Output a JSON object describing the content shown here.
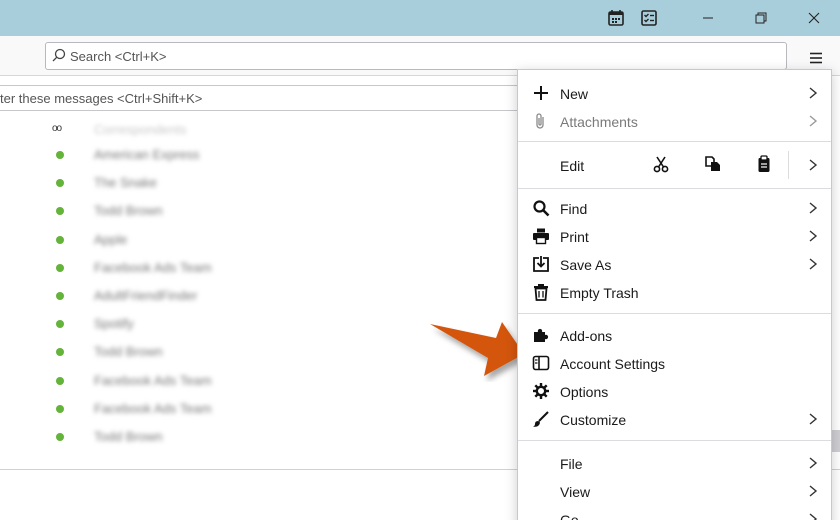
{
  "window": {
    "controls": [
      "calendar-icon",
      "tasks-icon",
      "minimize-icon",
      "maximize-icon",
      "close-icon"
    ]
  },
  "toolbar": {
    "search_placeholder": "Search <Ctrl+K>"
  },
  "filter": {
    "placeholder": "ter these messages <Ctrl+Shift+K>"
  },
  "message_list": {
    "header_label": "Correspondents",
    "rows": [
      {
        "sender": "American Express"
      },
      {
        "sender": "The Snake"
      },
      {
        "sender": "Todd Brown"
      },
      {
        "sender": "Apple"
      },
      {
        "sender": "Facebook Ads Team"
      },
      {
        "sender": "AdultFriendFinder"
      },
      {
        "sender": "Spotify"
      },
      {
        "sender": "Todd Brown"
      },
      {
        "sender": "Facebook Ads Team"
      },
      {
        "sender": "Facebook Ads Team"
      },
      {
        "sender": "Todd Brown"
      }
    ]
  },
  "app_menu": {
    "new": "New",
    "attachments": "Attachments",
    "edit": "Edit",
    "find": "Find",
    "print": "Print",
    "save_as": "Save As",
    "empty_trash": "Empty Trash",
    "addons": "Add-ons",
    "account_settings": "Account Settings",
    "options": "Options",
    "customize": "Customize",
    "file": "File",
    "view": "View",
    "go": "Go"
  },
  "colors": {
    "titlebar": "#a9cedb",
    "unread_dot": "#64b33a",
    "annotation_arrow": "#d4570f"
  }
}
